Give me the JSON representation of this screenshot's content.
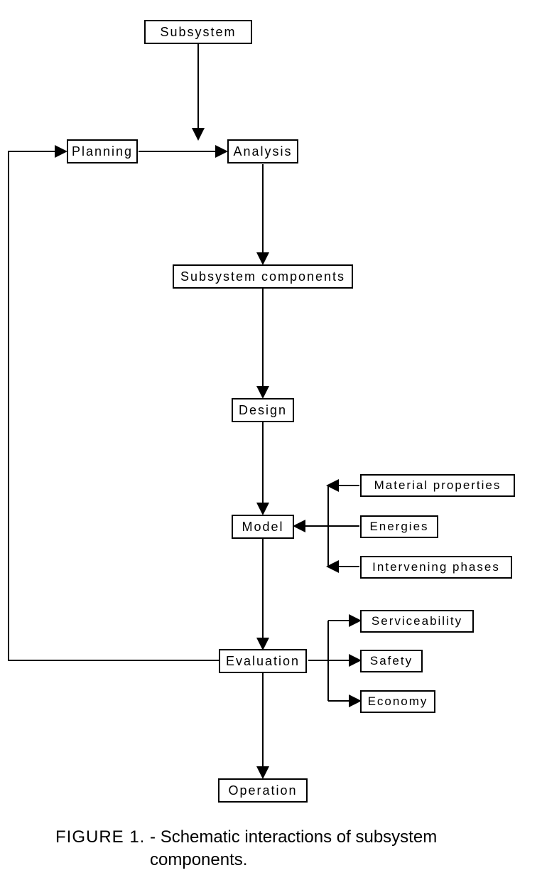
{
  "nodes": {
    "subsystem": "Subsystem",
    "planning": "Planning",
    "analysis": "Analysis",
    "subsystem_components": "Subsystem components",
    "design": "Design",
    "model": "Model",
    "material_properties": "Material properties",
    "energies": "Energies",
    "intervening_phases": "Intervening phases",
    "evaluation": "Evaluation",
    "serviceability": "Serviceability",
    "safety": "Safety",
    "economy": "Economy",
    "operation": "Operation"
  },
  "caption": {
    "figure_label": "FIGURE 1.",
    "text_line1": " - Schematic interactions of subsystem",
    "text_line2": "components."
  },
  "chart_data": {
    "type": "flowchart",
    "title": "Schematic interactions of subsystem components",
    "nodes": [
      {
        "id": "subsystem",
        "label": "Subsystem"
      },
      {
        "id": "planning",
        "label": "Planning"
      },
      {
        "id": "analysis",
        "label": "Analysis"
      },
      {
        "id": "subsystem_components",
        "label": "Subsystem components"
      },
      {
        "id": "design",
        "label": "Design"
      },
      {
        "id": "model",
        "label": "Model"
      },
      {
        "id": "material_properties",
        "label": "Material properties"
      },
      {
        "id": "energies",
        "label": "Energies"
      },
      {
        "id": "intervening_phases",
        "label": "Intervening phases"
      },
      {
        "id": "evaluation",
        "label": "Evaluation"
      },
      {
        "id": "serviceability",
        "label": "Serviceability"
      },
      {
        "id": "safety",
        "label": "Safety"
      },
      {
        "id": "economy",
        "label": "Economy"
      },
      {
        "id": "operation",
        "label": "Operation"
      }
    ],
    "edges": [
      {
        "from": "subsystem",
        "to": "analysis"
      },
      {
        "from": "planning",
        "to": "analysis"
      },
      {
        "from": "analysis",
        "to": "subsystem_components"
      },
      {
        "from": "subsystem_components",
        "to": "design"
      },
      {
        "from": "design",
        "to": "model"
      },
      {
        "from": "material_properties",
        "to": "model"
      },
      {
        "from": "energies",
        "to": "model"
      },
      {
        "from": "intervening_phases",
        "to": "model"
      },
      {
        "from": "model",
        "to": "evaluation"
      },
      {
        "from": "evaluation",
        "to": "serviceability"
      },
      {
        "from": "evaluation",
        "to": "safety"
      },
      {
        "from": "evaluation",
        "to": "economy"
      },
      {
        "from": "evaluation",
        "to": "operation"
      },
      {
        "from": "evaluation",
        "to": "planning",
        "note": "feedback loop"
      }
    ]
  }
}
